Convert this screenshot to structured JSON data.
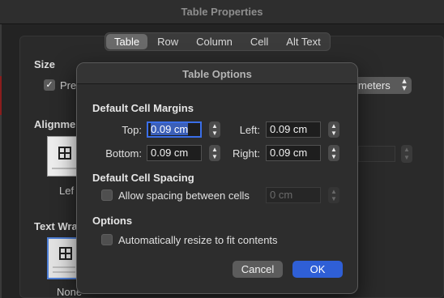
{
  "window": {
    "title": "Table Properties"
  },
  "tabs": [
    {
      "label": "Table",
      "active": true
    },
    {
      "label": "Row",
      "active": false
    },
    {
      "label": "Column",
      "active": false
    },
    {
      "label": "Cell",
      "active": false
    },
    {
      "label": "Alt Text",
      "active": false
    }
  ],
  "background": {
    "size_label": "Size",
    "preferred_width_partial": "Pre",
    "measure_in_partial": "meters",
    "alignment_label": "Alignme",
    "alignment_option_partial": "Lef",
    "text_wrapping_label": "Text Wra",
    "wrap_option_label": "None"
  },
  "dialog": {
    "title": "Table Options",
    "margins_heading": "Default Cell Margins",
    "top_label": "Top:",
    "top_value": "0.09 cm",
    "left_label": "Left:",
    "left_value": "0.09 cm",
    "bottom_label": "Bottom:",
    "bottom_value": "0.09 cm",
    "right_label": "Right:",
    "right_value": "0.09 cm",
    "spacing_heading": "Default Cell Spacing",
    "allow_spacing_label": "Allow spacing between cells",
    "allow_spacing_checked": false,
    "spacing_value": "0 cm",
    "options_heading": "Options",
    "autoresize_label": "Automatically resize to fit contents",
    "autoresize_checked": false,
    "cancel_label": "Cancel",
    "ok_label": "OK"
  },
  "colors": {
    "accent": "#2f5fd6",
    "focus_ring": "#3a6ee8",
    "dialog_bg": "#2d2d2d"
  }
}
